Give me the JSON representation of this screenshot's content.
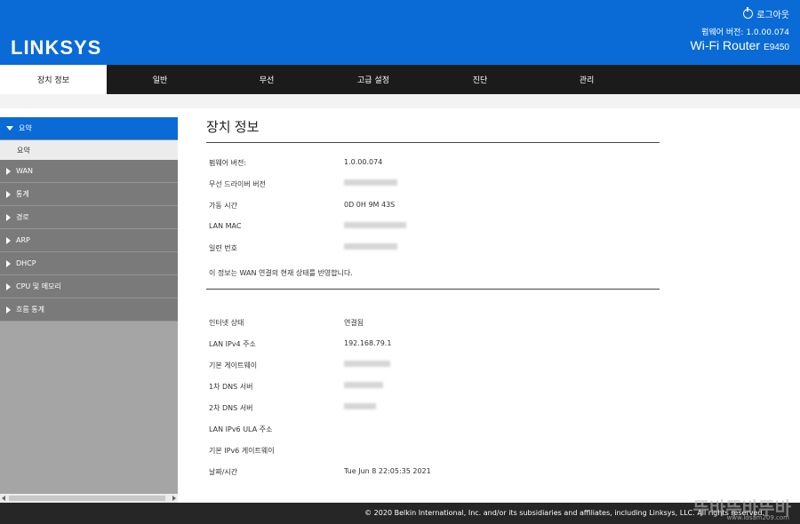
{
  "header": {
    "logo": "LINKSYS",
    "logout": "로그아웃",
    "firmware": "펌웨어 버전: 1.0.00.074",
    "model_name": "Wi-Fi Router",
    "model_code": "E9450"
  },
  "nav": {
    "tabs": [
      "장치 정보",
      "일반",
      "무선",
      "고급 설정",
      "진단",
      "관리"
    ]
  },
  "sidebar": {
    "items": [
      "요약",
      "WAN",
      "통계",
      "경로",
      "ARP",
      "DHCP",
      "CPU 및 메모리",
      "흐름 통계"
    ],
    "sub": "요약"
  },
  "main": {
    "title": "장치 정보",
    "section1": [
      {
        "label": "펌웨어 버전:",
        "value": "1.0.00.074"
      },
      {
        "label": "무선 드라이버 버전",
        "value": ""
      },
      {
        "label": "가동 시간",
        "value": "0D 0H 9M 43S"
      },
      {
        "label": "LAN MAC",
        "value": ""
      },
      {
        "label": "일련 번호",
        "value": ""
      }
    ],
    "note": "이 정보는 WAN 연결의 현재 상태를 반영합니다.",
    "section2": [
      {
        "label": "인터넷 상태",
        "value": "연결됨"
      },
      {
        "label": "LAN IPv4 주소",
        "value": "192.168.79.1"
      },
      {
        "label": "기본 게이트웨이",
        "value": ""
      },
      {
        "label": "1차 DNS 서버",
        "value": ""
      },
      {
        "label": "2차 DNS 서버",
        "value": ""
      },
      {
        "label": "LAN IPv6 ULA 주소",
        "value": ""
      },
      {
        "label": "기본 IPv6 게이트웨이",
        "value": ""
      },
      {
        "label": "날짜/시간",
        "value": "Tue Jun 8 22:05:35 2021"
      }
    ]
  },
  "footer": {
    "copyright": "© 2020 Belkin International, Inc. and/or its subsidiaries and affiliates, including Linksys, LLC. All rights reserved.",
    "watermark": "뚜바뚜바뚜바",
    "watermark_url": "www.ldsam209.com"
  }
}
